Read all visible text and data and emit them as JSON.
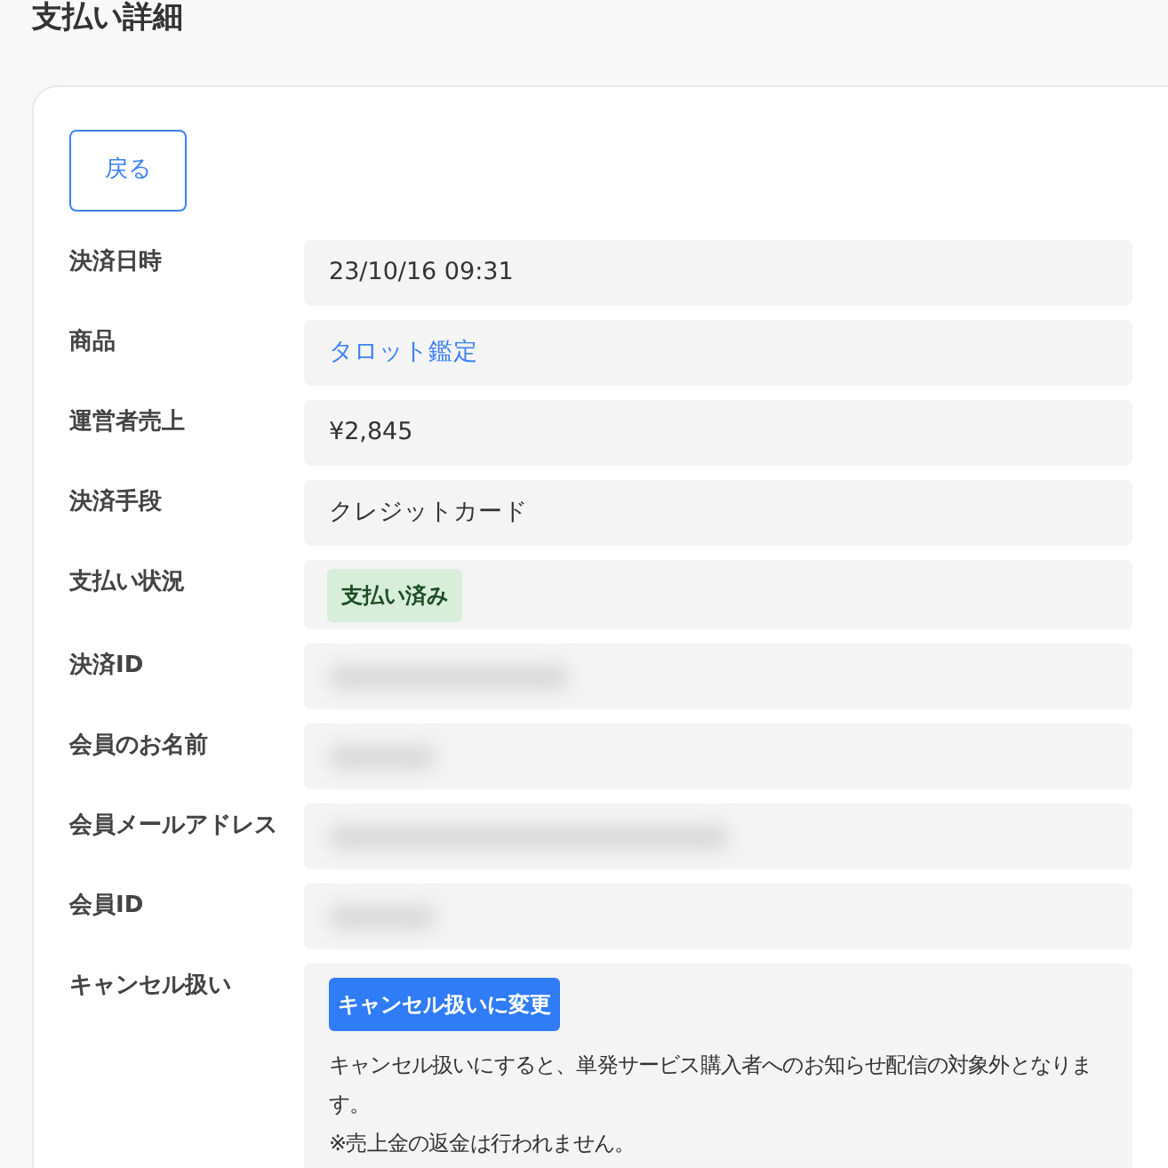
{
  "page_title": "支払い詳細",
  "back_button": "戻る",
  "fields": [
    {
      "label": "決済日時",
      "kind": "text",
      "value": "23/10/16 09:31"
    },
    {
      "label": "商品",
      "kind": "link",
      "value": "タロット鑑定"
    },
    {
      "label": "運営者売上",
      "kind": "text",
      "value": "¥2,845"
    },
    {
      "label": "決済手段",
      "kind": "text",
      "value": "クレジットカード"
    },
    {
      "label": "支払い状況",
      "kind": "badge",
      "value": "支払い済み"
    },
    {
      "label": "決済ID",
      "kind": "redacted"
    },
    {
      "label": "会員のお名前",
      "kind": "redacted"
    },
    {
      "label": "会員メールアドレス",
      "kind": "redacted"
    },
    {
      "label": "会員ID",
      "kind": "redacted"
    },
    {
      "label": "キャンセル扱い",
      "kind": "cancel",
      "button": "キャンセル扱いに変更",
      "note": "キャンセル扱いにすると、単発サービス購入者へのお知らせ配信の対象外となります。",
      "warning": "※売上金の返金は行われません。"
    }
  ]
}
